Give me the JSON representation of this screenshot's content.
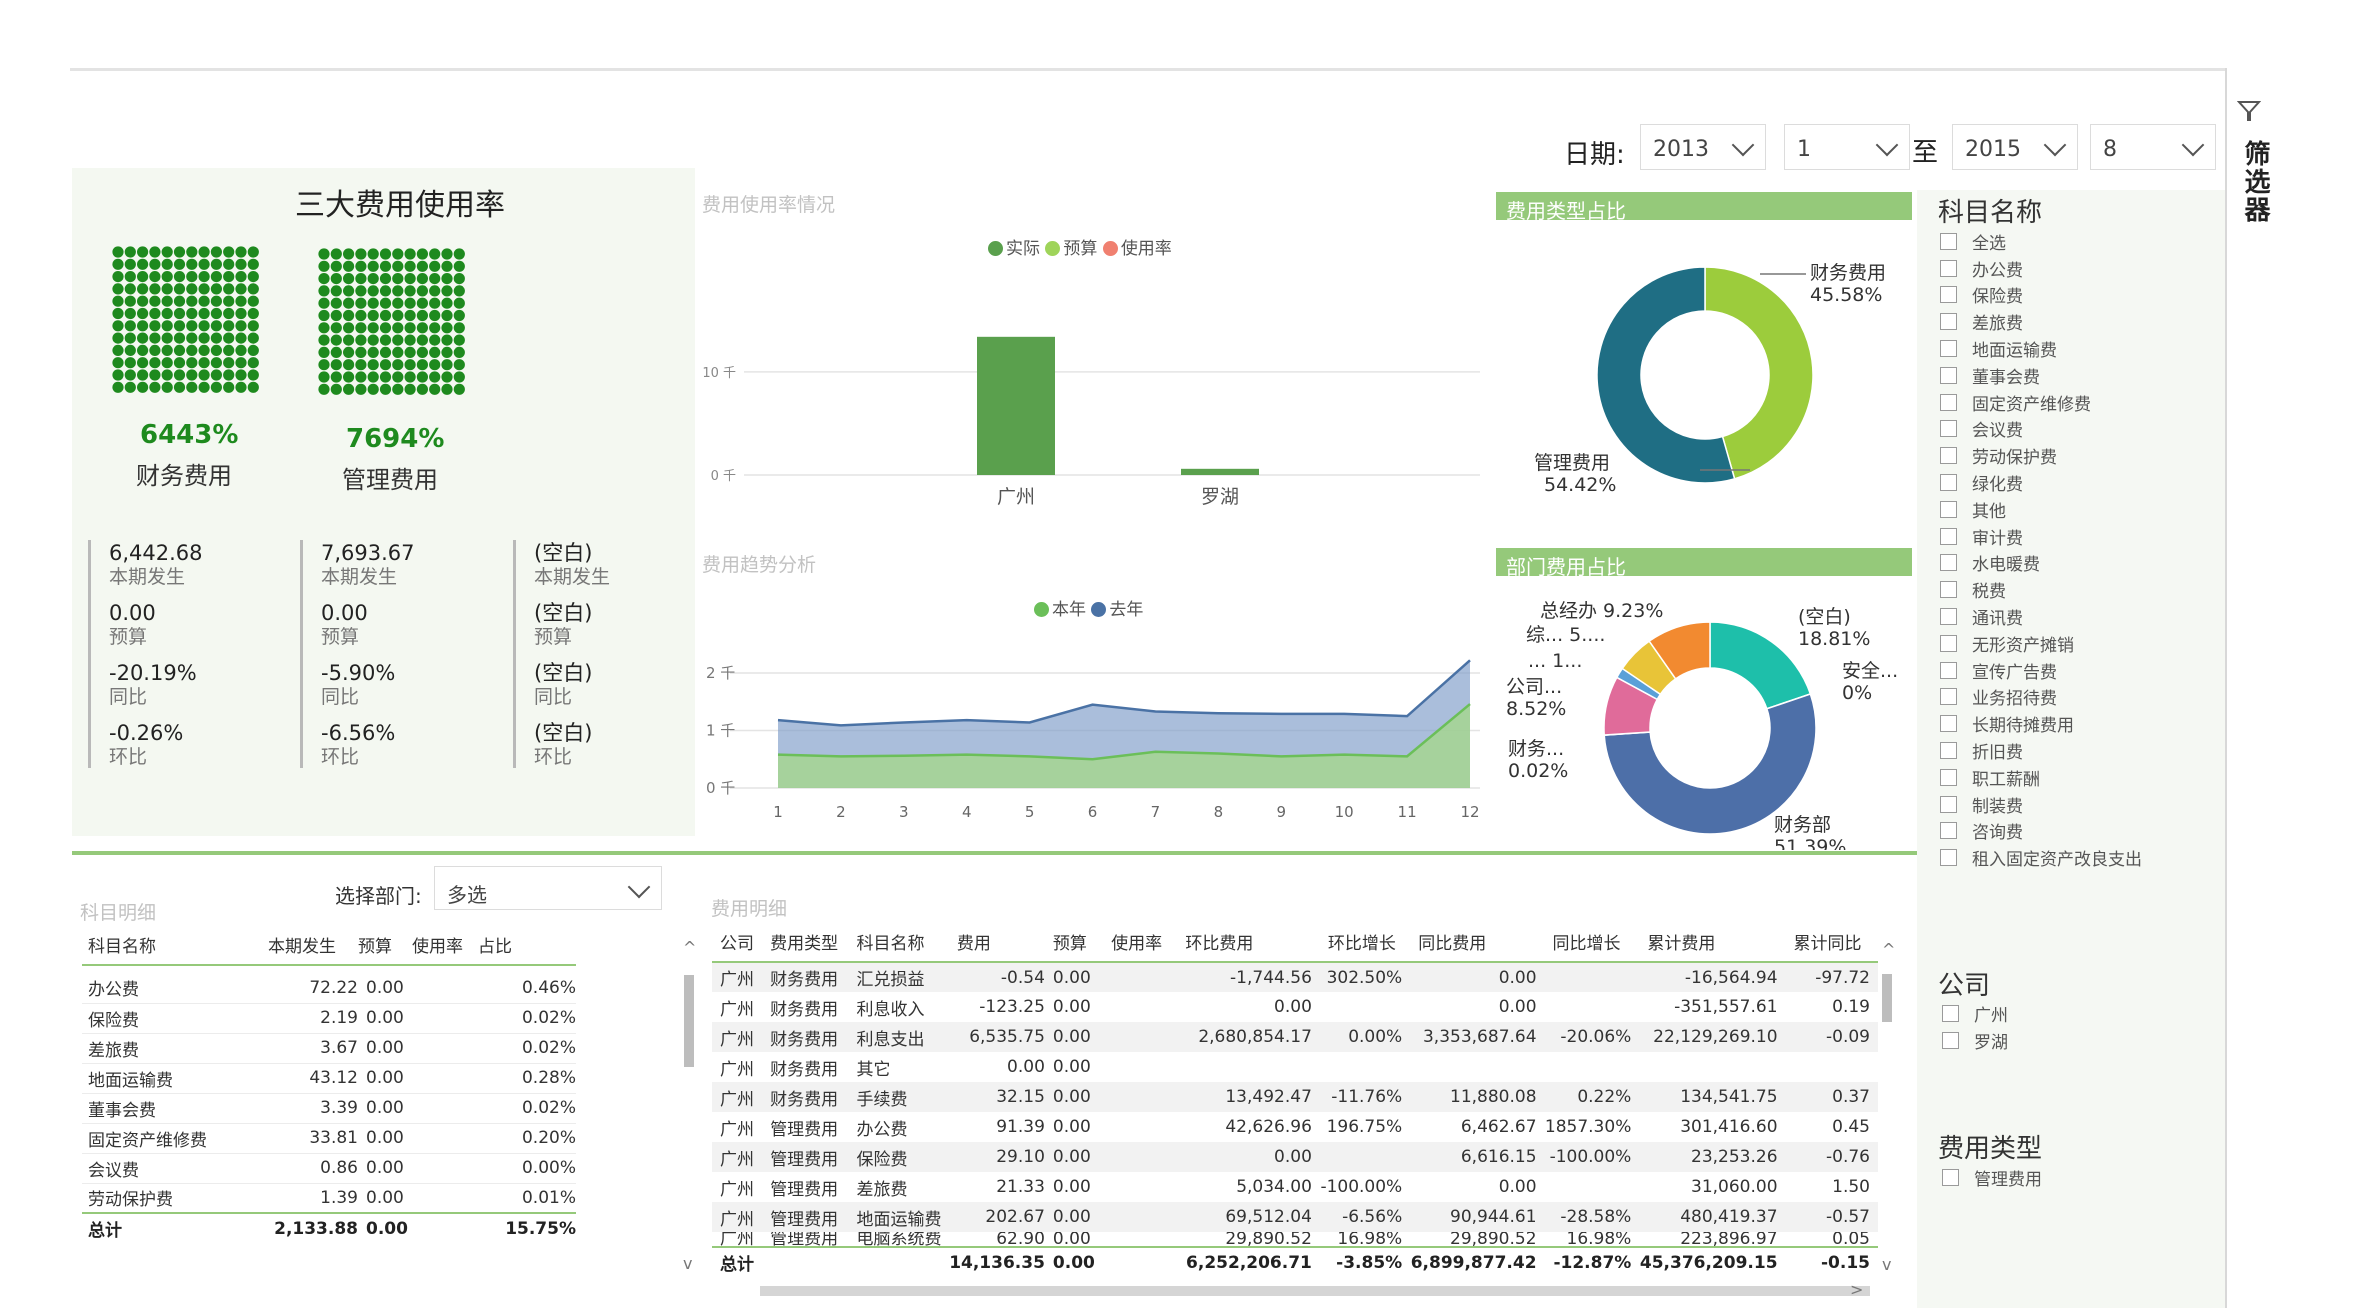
{
  "date_filter": {
    "label": "日期:",
    "from_year": "2013",
    "from_month": "1",
    "to_label": "至",
    "to_year": "2015",
    "to_month": "8"
  },
  "kpi": {
    "title": "三大费用使用率",
    "items": [
      {
        "pct": "6443%",
        "name": "财务费用"
      },
      {
        "pct": "7694%",
        "name": "管理费用"
      }
    ],
    "cols": [
      {
        "current": "6,442.68",
        "budget": "0.00",
        "yoy": "-20.19%",
        "mom": "-0.26%"
      },
      {
        "current": "7,693.67",
        "budget": "0.00",
        "yoy": "-5.90%",
        "mom": "-6.56%"
      },
      {
        "current": "(空白)",
        "budget": "(空白)",
        "yoy": "(空白)",
        "mom": "(空白)"
      }
    ],
    "labels": {
      "current": "本期发生",
      "budget": "预算",
      "yoy": "同比",
      "mom": "环比"
    },
    "dot_color": "#1e8a1e"
  },
  "usage_chart": {
    "title": "费用使用率情况",
    "legend": [
      "实际",
      "预算",
      "使用率"
    ],
    "legend_colors": [
      "#5aa04d",
      "#9fd45a",
      "#f08070"
    ],
    "y_ticks": [
      "10 千",
      "0 千"
    ]
  },
  "trend_chart": {
    "title": "费用趋势分析",
    "legend": [
      "本年",
      "去年"
    ],
    "legend_colors": [
      "#6bbf59",
      "#4a72a5"
    ],
    "y_ticks": [
      "2 千",
      "1 千",
      "0 千"
    ]
  },
  "type_share": {
    "title": "费用类型占比",
    "labels": [
      {
        "name": "财务费用",
        "pct": "45.58%"
      },
      {
        "name": "管理费用",
        "pct": "54.42%"
      }
    ]
  },
  "dept_share": {
    "title": "部门费用占比",
    "labels": {
      "l1": "总经办 9.23%",
      "l2": "综... 5....",
      "l3": "... 1...",
      "l4a": "公司...",
      "l4b": "8.52%",
      "l5a": "财务...",
      "l5b": "0.02%",
      "r1a": "(空白)",
      "r1b": "18.81%",
      "r2a": "安全...",
      "r2b": "0%",
      "r3a": "财务部",
      "r3b": "51.39%"
    }
  },
  "chart_data": [
    {
      "type": "bar",
      "title": "费用使用率情况",
      "categories": [
        "广州",
        "罗湖"
      ],
      "series": [
        {
          "name": "实际",
          "values": [
            13.4,
            0.6
          ]
        },
        {
          "name": "预算",
          "values": [
            0,
            0
          ]
        }
      ],
      "ylim": [
        0,
        16
      ],
      "y_ticks": [
        0,
        10
      ],
      "grid": true,
      "legend": "top"
    },
    {
      "type": "area",
      "title": "费用趋势分析",
      "x": [
        1,
        2,
        3,
        4,
        5,
        6,
        7,
        8,
        9,
        10,
        11,
        12
      ],
      "series": [
        {
          "name": "本年",
          "values": [
            0.58,
            0.55,
            0.56,
            0.58,
            0.55,
            0.5,
            0.63,
            0.6,
            0.55,
            0.58,
            0.55,
            1.46
          ]
        },
        {
          "name": "去年",
          "values": [
            1.18,
            1.09,
            1.14,
            1.18,
            1.14,
            1.45,
            1.33,
            1.3,
            1.29,
            1.29,
            1.25,
            2.22
          ]
        }
      ],
      "ylim": [
        0,
        2.4
      ],
      "y_ticks": [
        0,
        1,
        2
      ],
      "grid": true,
      "legend": "top"
    },
    {
      "type": "pie",
      "title": "费用类型占比",
      "categories": [
        "财务费用",
        "管理费用"
      ],
      "values": [
        45.58,
        54.42
      ],
      "colors": [
        "#9ccc3c",
        "#1f6e84"
      ]
    },
    {
      "type": "pie",
      "title": "部门费用占比",
      "categories": [
        "(空白)",
        "安全...",
        "财务部",
        "财务...",
        "公司...",
        "... 1...",
        "综... 5....",
        "总经办"
      ],
      "values": [
        18.81,
        0.01,
        51.39,
        0.02,
        8.52,
        1.5,
        5.5,
        9.23
      ],
      "colors": [
        "#1ebfaa",
        "#e0e0e0",
        "#4d6fa8",
        "#9ccc3c",
        "#e06b9a",
        "#5aa0d8",
        "#e8c438",
        "#f28a30"
      ]
    }
  ],
  "subject_detail": {
    "title": "科目明细",
    "dept_label": "选择部门:",
    "dept_value": "多选",
    "headers": [
      "科目名称",
      "本期发生",
      "预算",
      "使用率",
      "占比"
    ],
    "rows": [
      [
        "办公费",
        "72.22",
        "0.00",
        "",
        "0.46%"
      ],
      [
        "保险费",
        "2.19",
        "0.00",
        "",
        "0.02%"
      ],
      [
        "差旅费",
        "3.67",
        "0.00",
        "",
        "0.02%"
      ],
      [
        "地面运输费",
        "43.12",
        "0.00",
        "",
        "0.28%"
      ],
      [
        "董事会费",
        "3.39",
        "0.00",
        "",
        "0.02%"
      ],
      [
        "固定资产维修费",
        "33.81",
        "0.00",
        "",
        "0.20%"
      ],
      [
        "会议费",
        "0.86",
        "0.00",
        "",
        "0.00%"
      ],
      [
        "劳动保护费",
        "1.39",
        "0.00",
        "",
        "0.01%"
      ]
    ],
    "total": [
      "总计",
      "2,133.88",
      "0.00",
      "",
      "15.75%"
    ]
  },
  "cost_detail": {
    "title": "费用明细",
    "headers": [
      "公司",
      "费用类型",
      "科目名称",
      "费用",
      "预算",
      "使用率",
      "环比费用",
      "环比增长",
      "同比费用",
      "同比增长",
      "累计费用",
      "累计同比"
    ],
    "rows": [
      [
        "广州",
        "财务费用",
        "汇兑损益",
        "-0.54",
        "0.00",
        "",
        "-1,744.56",
        "302.50%",
        "0.00",
        "",
        "-16,564.94",
        "-97.72"
      ],
      [
        "广州",
        "财务费用",
        "利息收入",
        "-123.25",
        "0.00",
        "",
        "0.00",
        "",
        "0.00",
        "",
        "-351,557.61",
        "0.19"
      ],
      [
        "广州",
        "财务费用",
        "利息支出",
        "6,535.75",
        "0.00",
        "",
        "2,680,854.17",
        "0.00%",
        "3,353,687.64",
        "-20.06%",
        "22,129,269.10",
        "-0.09"
      ],
      [
        "广州",
        "财务费用",
        "其它",
        "0.00",
        "0.00",
        "",
        "",
        "",
        "",
        "",
        "",
        ""
      ],
      [
        "广州",
        "财务费用",
        "手续费",
        "32.15",
        "0.00",
        "",
        "13,492.47",
        "-11.76%",
        "11,880.08",
        "0.22%",
        "134,541.75",
        "0.37"
      ],
      [
        "广州",
        "管理费用",
        "办公费",
        "91.39",
        "0.00",
        "",
        "42,626.96",
        "196.75%",
        "6,462.67",
        "1857.30%",
        "301,416.60",
        "0.45"
      ],
      [
        "广州",
        "管理费用",
        "保险费",
        "29.10",
        "0.00",
        "",
        "0.00",
        "",
        "6,616.15",
        "-100.00%",
        "23,253.26",
        "-0.76"
      ],
      [
        "广州",
        "管理费用",
        "差旅费",
        "21.33",
        "0.00",
        "",
        "5,034.00",
        "-100.00%",
        "0.00",
        "",
        "31,060.00",
        "1.50"
      ],
      [
        "广州",
        "管理费用",
        "地面运输费",
        "202.67",
        "0.00",
        "",
        "69,512.04",
        "-6.56%",
        "90,944.61",
        "-28.58%",
        "480,419.37",
        "-0.57"
      ],
      [
        "广州",
        "管理费用",
        "电脑系统费",
        "62.90",
        "0.00",
        "",
        "29,890.52",
        "16.98%",
        "29,890.52",
        "16.98%",
        "223,896.97",
        "0.05"
      ]
    ],
    "total": [
      "总计",
      "",
      "",
      "14,136.35",
      "0.00",
      "",
      "6,252,206.71",
      "-3.85%",
      "6,899,877.42",
      "-12.87%",
      "45,376,209.15",
      "-0.15"
    ]
  },
  "filters": {
    "pane_title": "筛选器",
    "subject": {
      "title": "科目名称",
      "items": [
        "全选",
        "办公费",
        "保险费",
        "差旅费",
        "地面运输费",
        "董事会费",
        "固定资产维修费",
        "会议费",
        "劳动保护费",
        "绿化费",
        "其他",
        "审计费",
        "水电暖费",
        "税费",
        "通讯费",
        "无形资产摊销",
        "宣传广告费",
        "业务招待费",
        "长期待摊费用",
        "折旧费",
        "职工薪酬",
        "制装费",
        "咨询费",
        "租入固定资产改良支出"
      ]
    },
    "company": {
      "title": "公司",
      "items": [
        "广州",
        "罗湖"
      ]
    },
    "cost_type": {
      "title": "费用类型",
      "items": [
        "管理费用"
      ]
    }
  }
}
